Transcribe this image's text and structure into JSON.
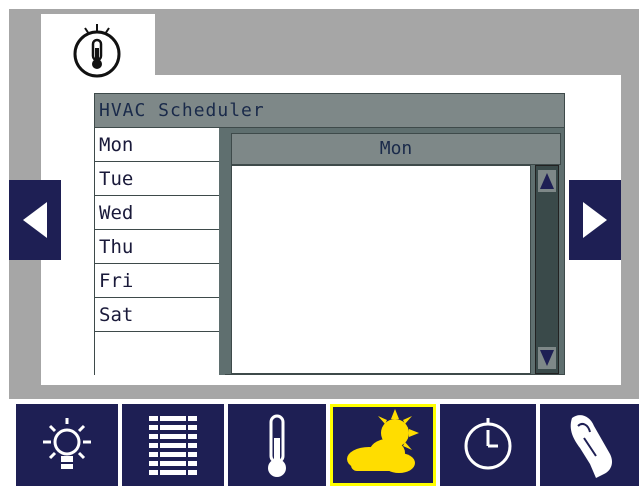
{
  "scheduler": {
    "title": "HVAC Scheduler",
    "selected_day": "Mon",
    "days": [
      "Mon",
      "Tue",
      "Wed",
      "Thu",
      "Fri",
      "Sat",
      ""
    ]
  },
  "tab": {
    "icon": "thermometer-tab-icon"
  },
  "nav": {
    "prev_icon": "arrow-left-icon",
    "next_icon": "arrow-right-icon"
  },
  "toolbar": {
    "buttons": [
      {
        "icon": "light-bulb-icon",
        "active": false
      },
      {
        "icon": "blinds-icon",
        "active": false
      },
      {
        "icon": "thermometer-icon",
        "active": false
      },
      {
        "icon": "weather-icon",
        "active": true
      },
      {
        "icon": "clock-icon",
        "active": false
      },
      {
        "icon": "cleaning-icon",
        "active": false
      }
    ]
  },
  "colors": {
    "navy": "#1e1f54",
    "panel_gray": "#a6a6a6",
    "header_gray": "#7e8888",
    "active_border": "#ffff00",
    "sun_yellow": "#ffdd00"
  }
}
